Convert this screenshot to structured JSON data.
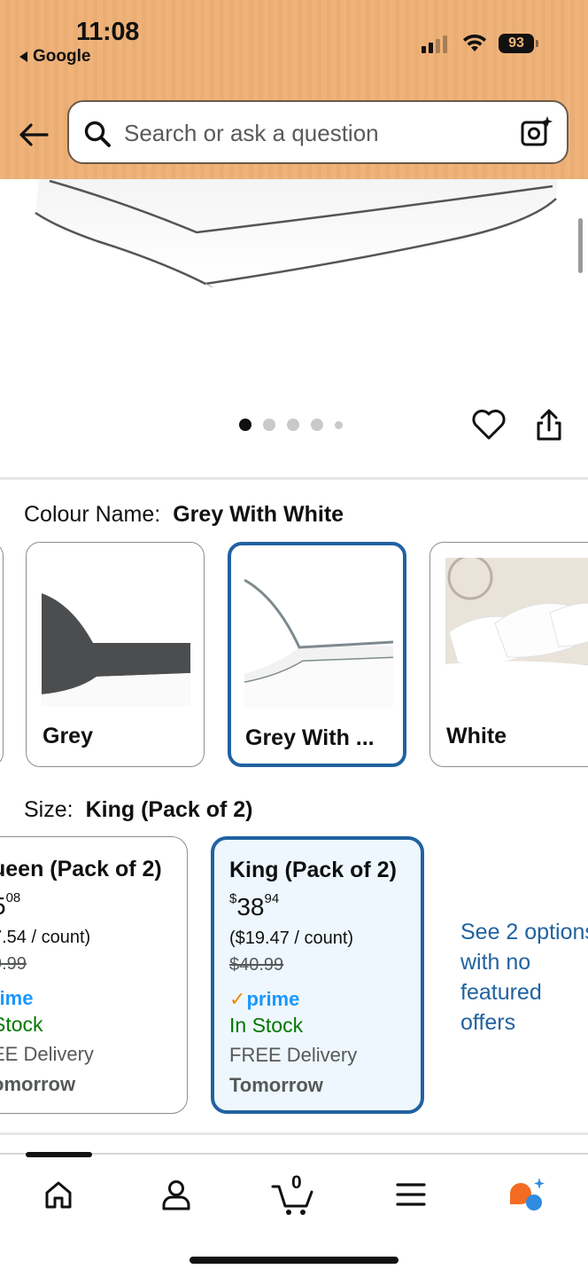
{
  "status_bar": {
    "time": "11:08",
    "back_app": "Google",
    "battery": "93"
  },
  "search": {
    "placeholder": "Search or ask a question",
    "value": ""
  },
  "gallery": {
    "image_count": 5,
    "active_index": 0
  },
  "colour": {
    "label": "Colour Name:",
    "selected": "Grey With White",
    "options": [
      {
        "name": "Grey"
      },
      {
        "name": "Grey With ..."
      },
      {
        "name": "White"
      }
    ],
    "selected_index": 1
  },
  "size": {
    "label": "Size:",
    "selected": "King (Pack of 2)",
    "options": [
      {
        "title": "ueen (Pack of 2)",
        "price_whole": "5",
        "price_fraction": "08",
        "unit_price": "7.54 / count)",
        "was_price": "9.99",
        "prime": "rime",
        "stock": "Stock",
        "delivery": "EE Delivery",
        "when": "omorrow"
      },
      {
        "title": "King (Pack of 2)",
        "price_symbol": "$",
        "price_whole": "38",
        "price_fraction": "94",
        "unit_price": "($19.47 / count)",
        "was_price": "$40.99",
        "prime": "prime",
        "stock": "In Stock",
        "delivery": "FREE Delivery",
        "when": "Tomorrow"
      }
    ],
    "see_more": "See 2 options with no featured offers"
  },
  "bottom_nav": {
    "items": [
      "home-icon",
      "account-icon",
      "cart-icon",
      "menu-icon",
      "rufus-assistant-icon"
    ],
    "cart_count": "0",
    "accent_color": "#f36c21",
    "assistant_color": "#2f8ce0"
  },
  "colors": {
    "header_bg": "#efb37a",
    "selected_border": "#2162a1",
    "in_stock": "#007600",
    "prime_blue": "#1a98ff",
    "link": "#2162a1"
  }
}
